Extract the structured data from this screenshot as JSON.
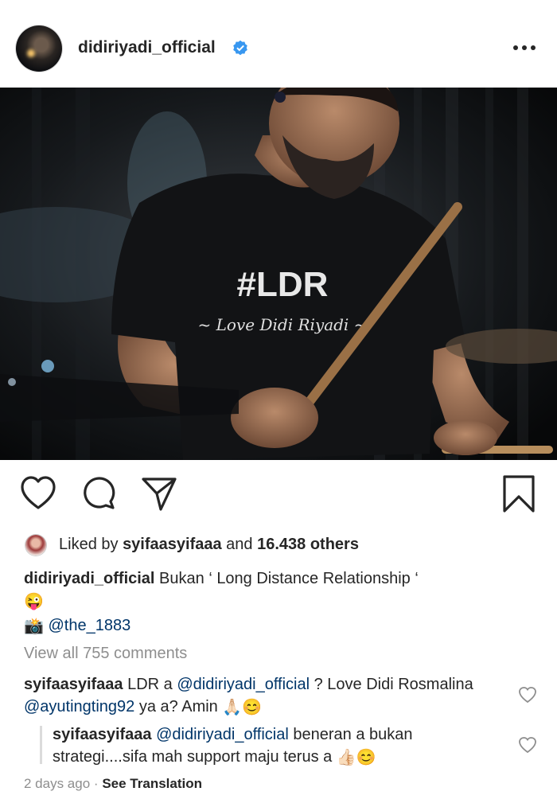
{
  "post": {
    "username": "didiriyadi_official",
    "verified_icon": "verified-badge-icon",
    "more_icon": "more-options-icon"
  },
  "photo": {
    "shirt_line1": "#LDR",
    "shirt_line2": "~ Love Didi Riyadi ~"
  },
  "actions": {
    "like_icon": "heart-icon",
    "comment_icon": "comment-icon",
    "share_icon": "share-icon",
    "save_icon": "bookmark-icon"
  },
  "likes": {
    "prefix": "Liked by",
    "user": "syifaasyifaaa",
    "conjunction": "and",
    "others": "16.438 others"
  },
  "caption": {
    "username": "didiriyadi_official",
    "text": "Bukan ‘ Long Distance Relationship ‘",
    "emoji": "😜",
    "credit_emoji": "📸",
    "credit_handle": "@the_1883"
  },
  "comments": {
    "view_all": "View all 755 comments",
    "items": [
      {
        "username": "syifaasyifaaa",
        "part1": "LDR a",
        "mention1": "@didiriyadi_official",
        "part2": "? Love Didi Rosmalina",
        "mention2": "@ayutingting92",
        "part3": "ya a? Amin",
        "emojis": "🙏🏻😊"
      },
      {
        "username": "syifaasyifaaa",
        "mention1": "@didiriyadi_official",
        "part1": "beneran a bukan strategi....sifa mah support maju terus a",
        "emojis": "👍🏻😊"
      }
    ]
  },
  "meta": {
    "time": "2 days ago",
    "separator": "·",
    "translate": "See Translation"
  }
}
